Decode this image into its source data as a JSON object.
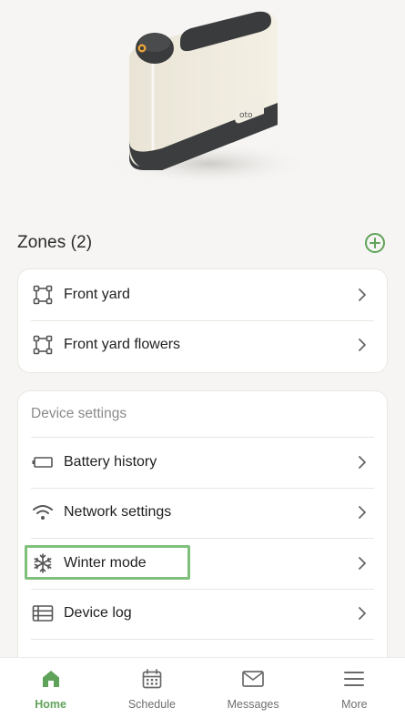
{
  "zones": {
    "title": "Zones (2)",
    "items": [
      {
        "label": "Front yard",
        "icon": "zone-square-icon"
      },
      {
        "label": "Front yard flowers",
        "icon": "zone-square-icon"
      }
    ]
  },
  "device_settings": {
    "section_title": "Device settings",
    "items": [
      {
        "label": "Battery history",
        "icon": "battery-icon"
      },
      {
        "label": "Network settings",
        "icon": "wifi-icon"
      },
      {
        "label": "Winter mode",
        "icon": "snowflake-icon"
      },
      {
        "label": "Device log",
        "icon": "log-list-icon"
      }
    ]
  },
  "tabbar": {
    "tabs": [
      {
        "label": "Home",
        "icon": "home-icon",
        "active": true
      },
      {
        "label": "Schedule",
        "icon": "calendar-icon",
        "active": false
      },
      {
        "label": "Messages",
        "icon": "mail-icon",
        "active": false
      },
      {
        "label": "More",
        "icon": "menu-icon",
        "active": false
      }
    ]
  },
  "colors": {
    "accent": "#5fa35a",
    "highlight": "#7fc07a",
    "background": "#f6f5f3"
  },
  "device_logo": "oto"
}
